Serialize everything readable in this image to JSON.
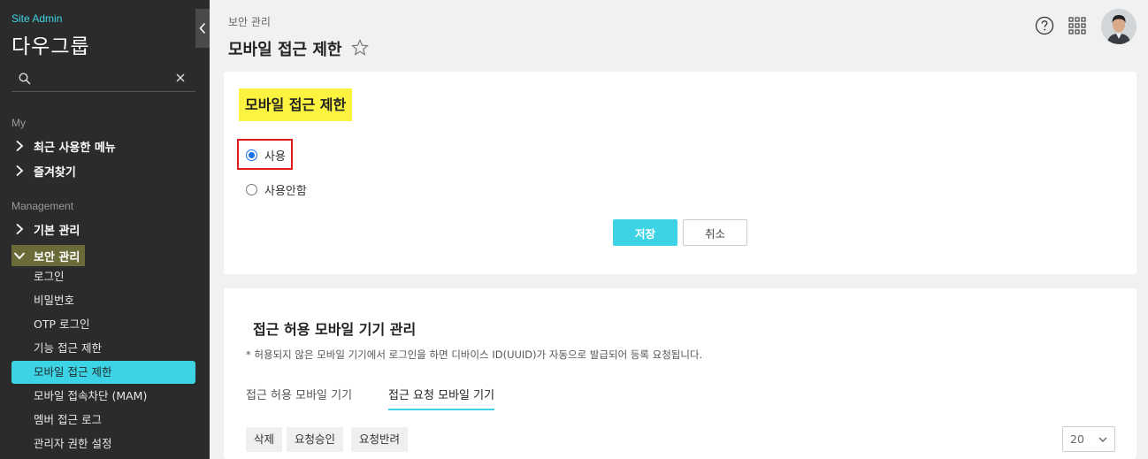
{
  "sidebar": {
    "site_admin": "Site Admin",
    "org_name": "다우그룹",
    "search": {
      "placeholder": "",
      "value": ""
    },
    "section_my": "My",
    "my_items": [
      {
        "label": "최근 사용한 메뉴"
      },
      {
        "label": "즐겨찾기"
      }
    ],
    "section_management": "Management",
    "mgmt_items": [
      {
        "label": "기본 관리"
      },
      {
        "label": "보안 관리"
      }
    ],
    "security_sub_items": [
      {
        "label": "로그인"
      },
      {
        "label": "비밀번호"
      },
      {
        "label": "OTP 로그인"
      },
      {
        "label": "기능 접근 제한"
      },
      {
        "label": "모바일 접근 제한"
      },
      {
        "label": "모바일 접속차단 (MAM)"
      },
      {
        "label": "멤버 접근 로그"
      },
      {
        "label": "관리자 권한 설정"
      }
    ],
    "selected_item": "모바일 접근 제한",
    "accent_color": "#3cd3e4"
  },
  "header": {
    "breadcrumb": "보안 관리",
    "title": "모바일 접근 제한",
    "icons": [
      "star-icon",
      "help-icon",
      "apps-grid-icon",
      "avatar"
    ]
  },
  "settings_card": {
    "title": "모바일 접근 제한",
    "options": [
      {
        "label": "사용",
        "checked": true
      },
      {
        "label": "사용안함",
        "checked": false
      }
    ],
    "save_label": "저장",
    "cancel_label": "취소"
  },
  "device_card": {
    "title": "접근 허용 모바일 기기 관리",
    "note": "* 허용되지 않은 모바일 기기에서 로그인을 하면 디바이스 ID(UUID)가 자동으로 발급되어 등록 요청됩니다.",
    "tabs": [
      {
        "label": "접근 허용 모바일 기기",
        "active": false
      },
      {
        "label": "접근 요청 모바일 기기",
        "active": true
      }
    ],
    "actions": [
      {
        "label": "삭제"
      },
      {
        "label": "요청승인"
      },
      {
        "label": "요청반려"
      }
    ],
    "page_size": "20"
  }
}
